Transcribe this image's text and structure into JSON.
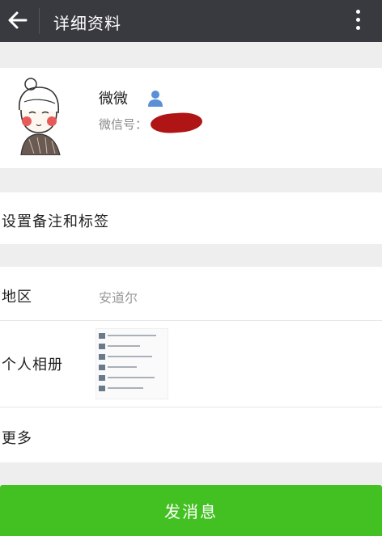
{
  "header": {
    "title": "详细资料"
  },
  "profile": {
    "name": "微微",
    "wechat_id_label": "微信号："
  },
  "remark": {
    "label": "设置备注和标签"
  },
  "details": {
    "region_label": "地区",
    "region_value": "安道尔",
    "album_label": "个人相册",
    "more_label": "更多"
  },
  "actions": {
    "send_message_label": "发消息"
  },
  "colors": {
    "topbar": "#393a3f",
    "send_button": "#44c122",
    "redaction": "#b01515",
    "contact_icon": "#5b8fd6"
  },
  "icons": [
    "back-arrow-icon",
    "more-vertical-icon",
    "contact-person-icon"
  ]
}
